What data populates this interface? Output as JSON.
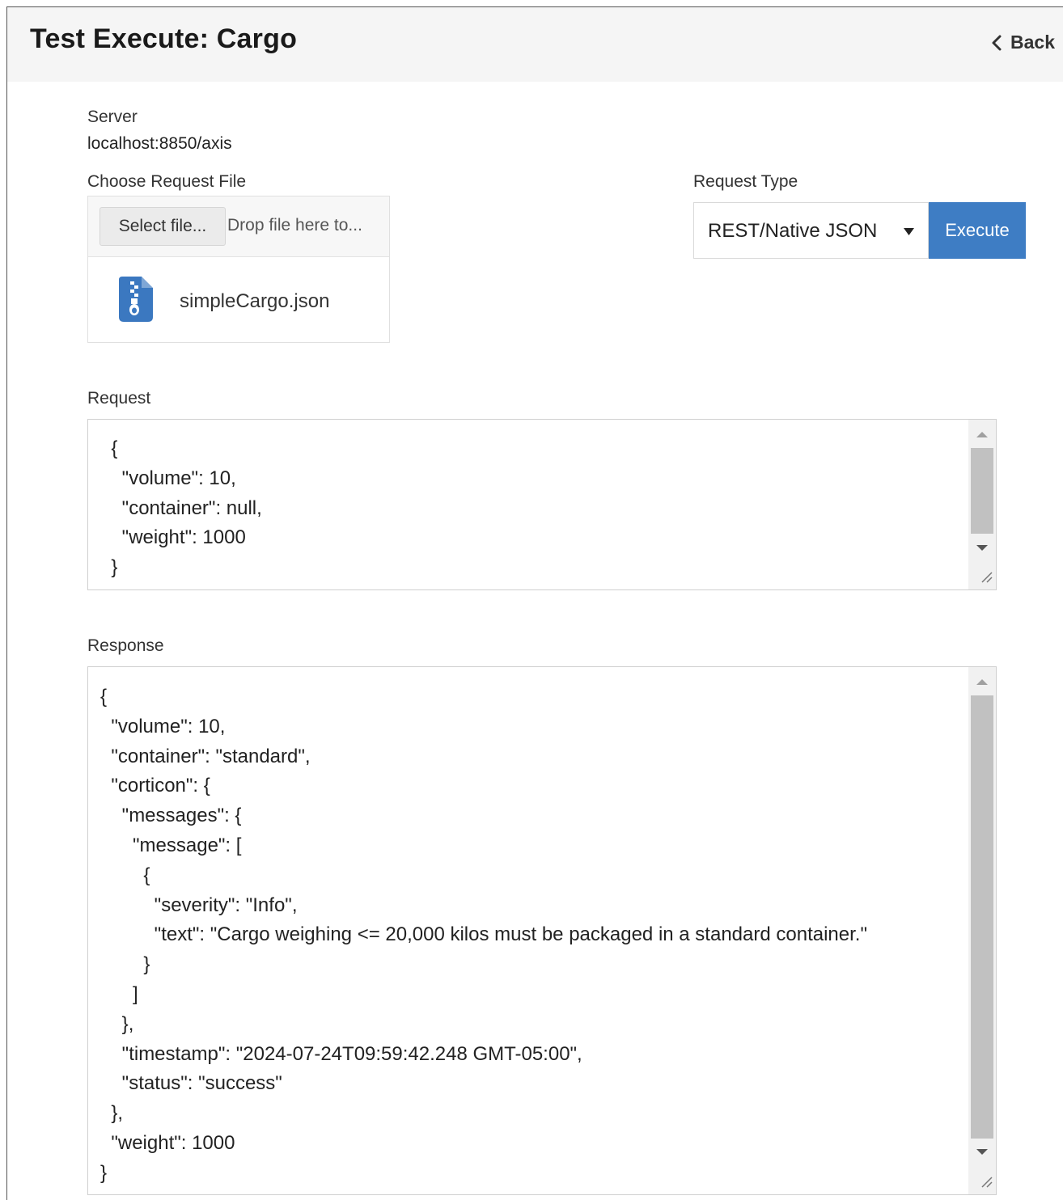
{
  "header": {
    "title": "Test Execute: Cargo",
    "back_label": "Back"
  },
  "server": {
    "label": "Server",
    "value": "localhost:8850/axis"
  },
  "request_file": {
    "label": "Choose Request File",
    "select_button": "Select file...",
    "drop_hint": "Drop file here to...",
    "file_name": "simpleCargo.json",
    "file_icon": "zip-file-icon"
  },
  "request_type": {
    "label": "Request Type",
    "selected": "REST/Native JSON",
    "execute_label": "Execute"
  },
  "request": {
    "label": "Request",
    "content": "  {\n    \"volume\": 10,\n    \"container\": null,\n    \"weight\": 1000\n  }"
  },
  "response": {
    "label": "Response",
    "content": "{\n  \"volume\": 10,\n  \"container\": \"standard\",\n  \"corticon\": {\n    \"messages\": {\n      \"message\": [\n        {\n          \"severity\": \"Info\",\n          \"text\": \"Cargo weighing <= 20,000 kilos must be packaged in a standard container.\"\n        }\n      ]\n    },\n    \"timestamp\": \"2024-07-24T09:59:42.248 GMT-05:00\",\n    \"status\": \"success\"\n  },\n  \"weight\": 1000\n}"
  },
  "colors": {
    "primary_button": "#3e7dc4",
    "file_icon": "#3b78c0",
    "header_bg": "#f5f5f5"
  }
}
